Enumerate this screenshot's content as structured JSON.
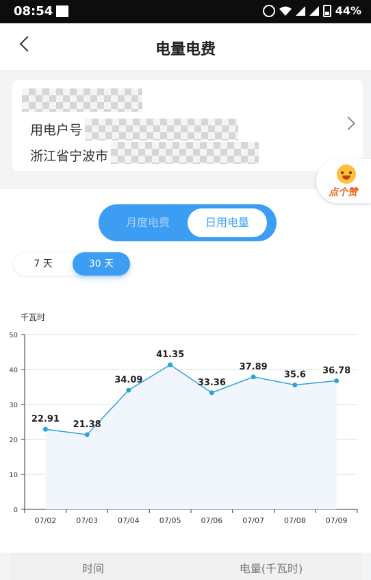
{
  "status": {
    "time": "08:54",
    "battery": "44%"
  },
  "header": {
    "title": "电量电费"
  },
  "account": {
    "label": "用电户号",
    "address": "浙江省宁波市"
  },
  "like": {
    "label": "点个赞"
  },
  "tabs": {
    "monthly": "月度电费",
    "daily": "日用电量",
    "selected": "日用电量"
  },
  "range": {
    "r7": "7 天",
    "r30": "30 天",
    "selected": "30 天"
  },
  "chart_data": {
    "type": "line",
    "ylabel": "千瓦时",
    "ylim": [
      0,
      50
    ],
    "yticks": [
      0,
      10,
      20,
      30,
      40,
      50
    ],
    "categories": [
      "07/02",
      "07/03",
      "07/04",
      "07/05",
      "07/06",
      "07/07",
      "07/08",
      "07/09"
    ],
    "values": [
      22.91,
      21.38,
      34.09,
      41.35,
      33.36,
      37.89,
      35.6,
      36.78
    ],
    "labels": [
      "22.91",
      "21.38",
      "34.09",
      "41.35",
      "33.36",
      "37.89",
      "35.6",
      "36.78"
    ],
    "line_color": "#2aa3d6",
    "area_color": "#f1f6fc",
    "grid": true
  },
  "table": {
    "col_time": "时间",
    "col_energy": "电量(千瓦时)"
  }
}
